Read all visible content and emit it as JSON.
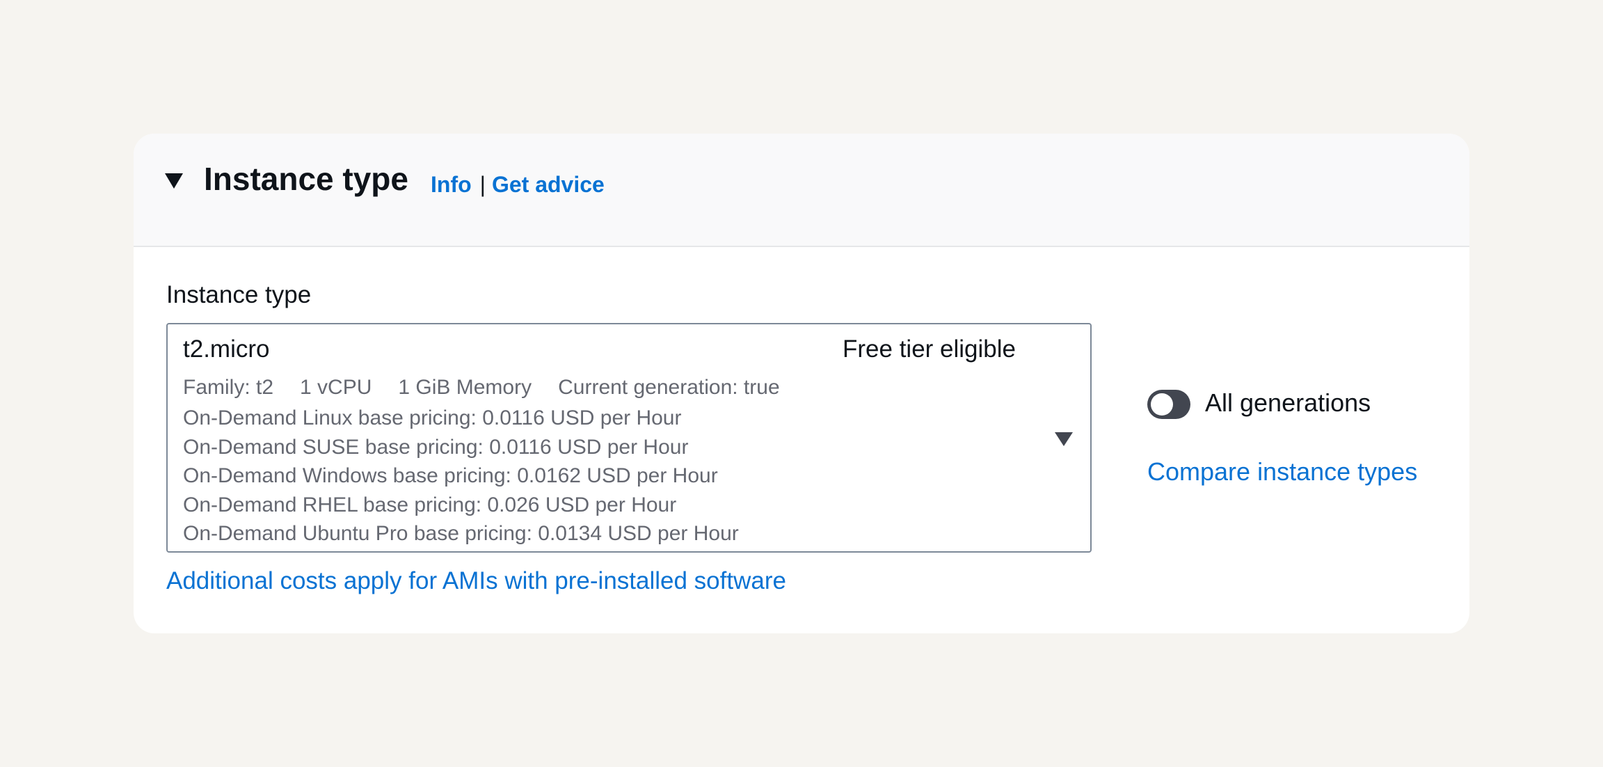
{
  "section": {
    "title": "Instance type",
    "info_link": "Info",
    "separator": "|",
    "advice_link": "Get advice",
    "expanded_icon": "caret-down-icon"
  },
  "field": {
    "label": "Instance type"
  },
  "selected_option": {
    "name": "t2.micro",
    "tag": "Free tier eligible",
    "meta": [
      "Family: t2",
      "1 vCPU",
      "1 GiB Memory",
      "Current generation: true"
    ],
    "pricing": [
      "On-Demand Linux base pricing: 0.0116 USD per Hour",
      "On-Demand SUSE base pricing: 0.0116 USD per Hour",
      "On-Demand Windows base pricing: 0.0162 USD per Hour",
      "On-Demand RHEL base pricing: 0.026 USD per Hour",
      "On-Demand Ubuntu Pro base pricing: 0.0134 USD per Hour"
    ]
  },
  "additional_costs_link": "Additional costs apply for AMIs with pre-installed software",
  "toggle": {
    "label": "All generations",
    "checked": false
  },
  "compare_link": "Compare instance types",
  "colors": {
    "link": "#0972d3",
    "text": "#0f141a",
    "secondary_text": "#656871",
    "page_background": "#f6f4f0",
    "header_background": "#f9f9fa",
    "toggle_off": "#424650"
  }
}
